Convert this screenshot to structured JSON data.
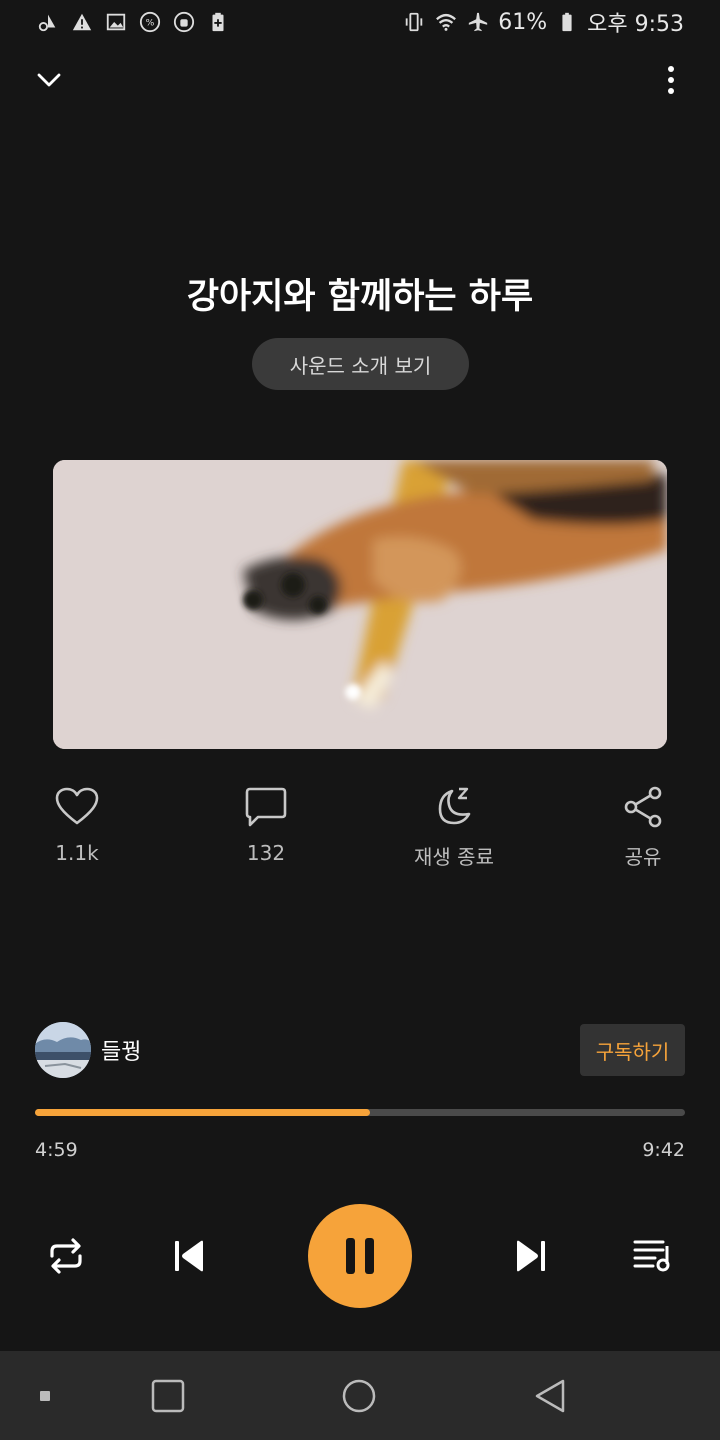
{
  "status_bar": {
    "left_icons": [
      "bike-warning-icon",
      "warning-icon",
      "image-icon",
      "percent-icon",
      "android-icon",
      "battery-plus-icon"
    ],
    "right_icons": [
      "vibrate-icon",
      "wifi-icon",
      "airplane-icon"
    ],
    "battery": "61%",
    "time": "오후 9:53"
  },
  "header": {
    "collapse_icon": "chevron-down-icon",
    "more_icon": "more-vertical-icon"
  },
  "track": {
    "title": "강아지와 함께하는 하루",
    "intro_button": "사운드 소개 보기"
  },
  "actions": {
    "like": {
      "icon": "heart-icon",
      "label": "1.1k"
    },
    "comment": {
      "icon": "comment-icon",
      "label": "132"
    },
    "sleep_timer": {
      "icon": "moon-icon",
      "label": "재생 종료"
    },
    "share": {
      "icon": "share-icon",
      "label": "공유"
    }
  },
  "channel": {
    "name": "들꿩",
    "subscribe_label": "구독하기"
  },
  "player": {
    "progress": 0.515,
    "current_time": "4:59",
    "total_time": "9:42",
    "accent_color": "#f6a33a"
  },
  "controls": {
    "repeat_icon": "repeat-icon",
    "previous_icon": "skip-previous-icon",
    "pause_icon": "pause-icon",
    "next_icon": "skip-next-icon",
    "playlist_icon": "playlist-icon"
  },
  "nav_bar": {
    "icons": [
      "recents-dot-icon",
      "recent-apps-icon",
      "home-icon",
      "back-icon"
    ]
  }
}
